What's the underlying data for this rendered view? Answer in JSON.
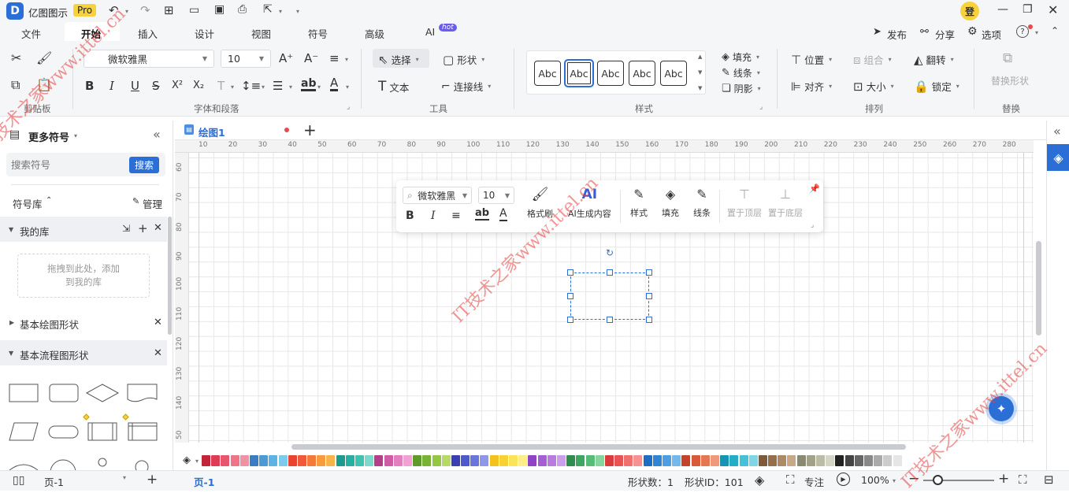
{
  "app": {
    "name": "亿图图示",
    "badge": "Pro",
    "login": "登"
  },
  "menu": {
    "tabs": [
      "文件",
      "开始",
      "插入",
      "设计",
      "视图",
      "符号",
      "高级",
      "AI"
    ],
    "ai_badge": "hot",
    "right": {
      "publish": "发布",
      "share": "分享",
      "options": "选项",
      "help": "?"
    }
  },
  "ribbon": {
    "font_name": "微软雅黑",
    "font_size": "10",
    "bold": "B",
    "italic": "I",
    "underline": "U",
    "strike": "S",
    "superscript": "X²",
    "subscript": "X₂",
    "text_effect": "T",
    "highlight": "ab",
    "font_color": "A",
    "select": "选择",
    "shape": "形状",
    "text": "文本",
    "connector": "连接线",
    "style_samples": [
      "Abc",
      "Abc",
      "Abc",
      "Abc",
      "Abc"
    ],
    "fill": "填充",
    "line": "线条",
    "shadow": "阴影",
    "position": "位置",
    "group": "组合",
    "flip": "翻转",
    "align": "对齐",
    "size": "大小",
    "lock": "锁定",
    "replace_shape": "替换形状",
    "groups": {
      "clipboard": "剪贴板",
      "font": "字体和段落",
      "tools": "工具",
      "styles": "样式",
      "arrange": "排列",
      "replace": "替换"
    }
  },
  "left_panel": {
    "title": "更多符号",
    "search_placeholder": "搜索符号",
    "search_button": "搜索",
    "library_label": "符号库",
    "manage": "管理",
    "my_library": "我的库",
    "drop_hint": "拖拽到此处，添加到我的库",
    "basic_shapes": "基本绘图形状",
    "basic_flowchart": "基本流程图形状"
  },
  "doc": {
    "tab_title": "绘图1"
  },
  "ruler": {
    "top": [
      "10",
      "20",
      "30",
      "40",
      "50",
      "60",
      "70",
      "80",
      "90",
      "100",
      "110",
      "120",
      "130",
      "140",
      "150",
      "160",
      "170",
      "180",
      "190",
      "200",
      "210",
      "220",
      "230",
      "240",
      "250",
      "260",
      "270",
      "280"
    ],
    "left": [
      "60",
      "70",
      "80",
      "90",
      "100",
      "110",
      "120",
      "130",
      "140",
      "50"
    ]
  },
  "float_toolbar": {
    "font_name": "微软雅黑",
    "font_size": "10",
    "format_painter": "格式刷",
    "ai_generate": "AI生成内容",
    "style": "样式",
    "fill": "填充",
    "line": "线条",
    "bring_front": "置于顶层",
    "send_back": "置于底层",
    "ai_glyph": "AI"
  },
  "palette": [
    "#c0253a",
    "#e03b55",
    "#e8556f",
    "#f07488",
    "#ef93a4",
    "#3a7dc4",
    "#4a9ad6",
    "#5cb4e4",
    "#7ccbee",
    "#e8442f",
    "#f05a3a",
    "#f47a39",
    "#f79b3d",
    "#f7b44a",
    "#1a9b8e",
    "#26b0a1",
    "#3fc3b1",
    "#7fd8cc",
    "#b33e8a",
    "#d05ca6",
    "#e47fbf",
    "#f0a3d3",
    "#5f9b2a",
    "#79b335",
    "#93c744",
    "#b6d96a",
    "#3a3fb3",
    "#4f59cc",
    "#6a75dc",
    "#8f97e6",
    "#f4c21c",
    "#f8d232",
    "#fbe35a",
    "#fdee8a",
    "#8e44c4",
    "#a35fd4",
    "#b87be0",
    "#cd9ded",
    "#2c8d4e",
    "#3ea660",
    "#56bd77",
    "#85d59c",
    "#d93c3c",
    "#e85454",
    "#f07070",
    "#f59393",
    "#1b6ec2",
    "#2e85d4",
    "#4b9fe2",
    "#74b9ec",
    "#c4432a",
    "#d85a3a",
    "#e67753",
    "#ef9a7c",
    "#1795b0",
    "#24adc7",
    "#45c2d8",
    "#7fd7e6",
    "#7c5a3a",
    "#946f4a",
    "#ac8a65",
    "#c7a988",
    "#8a8a72",
    "#a2a28a",
    "#bbbba6",
    "#d5d5c6",
    "#222222",
    "#444444",
    "#666666",
    "#888888",
    "#aaaaaa",
    "#cccccc",
    "#e6e6e6"
  ],
  "status": {
    "page_select": "页-1",
    "page_tab": "页-1",
    "shape_count": "形状数：1",
    "shape_id": "形状ID：101",
    "focus": "专注",
    "zoom": "100%"
  },
  "watermark": "IT技术之家www.ittel.cn",
  "colors": {
    "accent": "#2b6fd6",
    "pro_badge": "#f7d23c",
    "hot_badge": "#6a5cf0"
  }
}
